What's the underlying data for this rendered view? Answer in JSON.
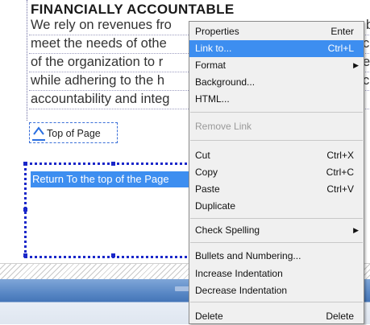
{
  "document": {
    "heading": "FINANCIALLY ACCOUNTABLE",
    "body_lines": [
      "We rely on revenues fro",
      "meet the needs of othe",
      "of the organization to r",
      "while adhering to the h",
      "accountability and integ"
    ],
    "body_lines_right": [
      "b",
      "ci",
      "er",
      "ci",
      ""
    ],
    "top_link_label": "Top of Page",
    "selected_text": "Return To the top of the Page"
  },
  "context_menu": {
    "items": [
      {
        "label": "Properties",
        "shortcut": "Enter"
      },
      {
        "label": "Link to...",
        "shortcut": "Ctrl+L",
        "highlighted": true
      },
      {
        "label": "Format",
        "submenu": true
      },
      {
        "label": "Background..."
      },
      {
        "label": "HTML..."
      },
      {
        "label": "Remove Link",
        "disabled": true
      },
      {
        "label": "Cut",
        "shortcut": "Ctrl+X"
      },
      {
        "label": "Copy",
        "shortcut": "Ctrl+C"
      },
      {
        "label": "Paste",
        "shortcut": "Ctrl+V"
      },
      {
        "label": "Duplicate"
      },
      {
        "label": "Check Spelling",
        "submenu": true
      },
      {
        "label": "Bullets and Numbering..."
      },
      {
        "label": "Increase Indentation"
      },
      {
        "label": "Decrease Indentation"
      },
      {
        "label": "Delete",
        "shortcut": "Delete"
      }
    ]
  },
  "colors": {
    "highlight": "#3d8ef0",
    "selection_border": "#1a27c9",
    "menu_background": "#f0f0f0"
  },
  "icons": {
    "submenu": "submenu-arrow-icon",
    "top_of_page": "caret-up-icon"
  }
}
